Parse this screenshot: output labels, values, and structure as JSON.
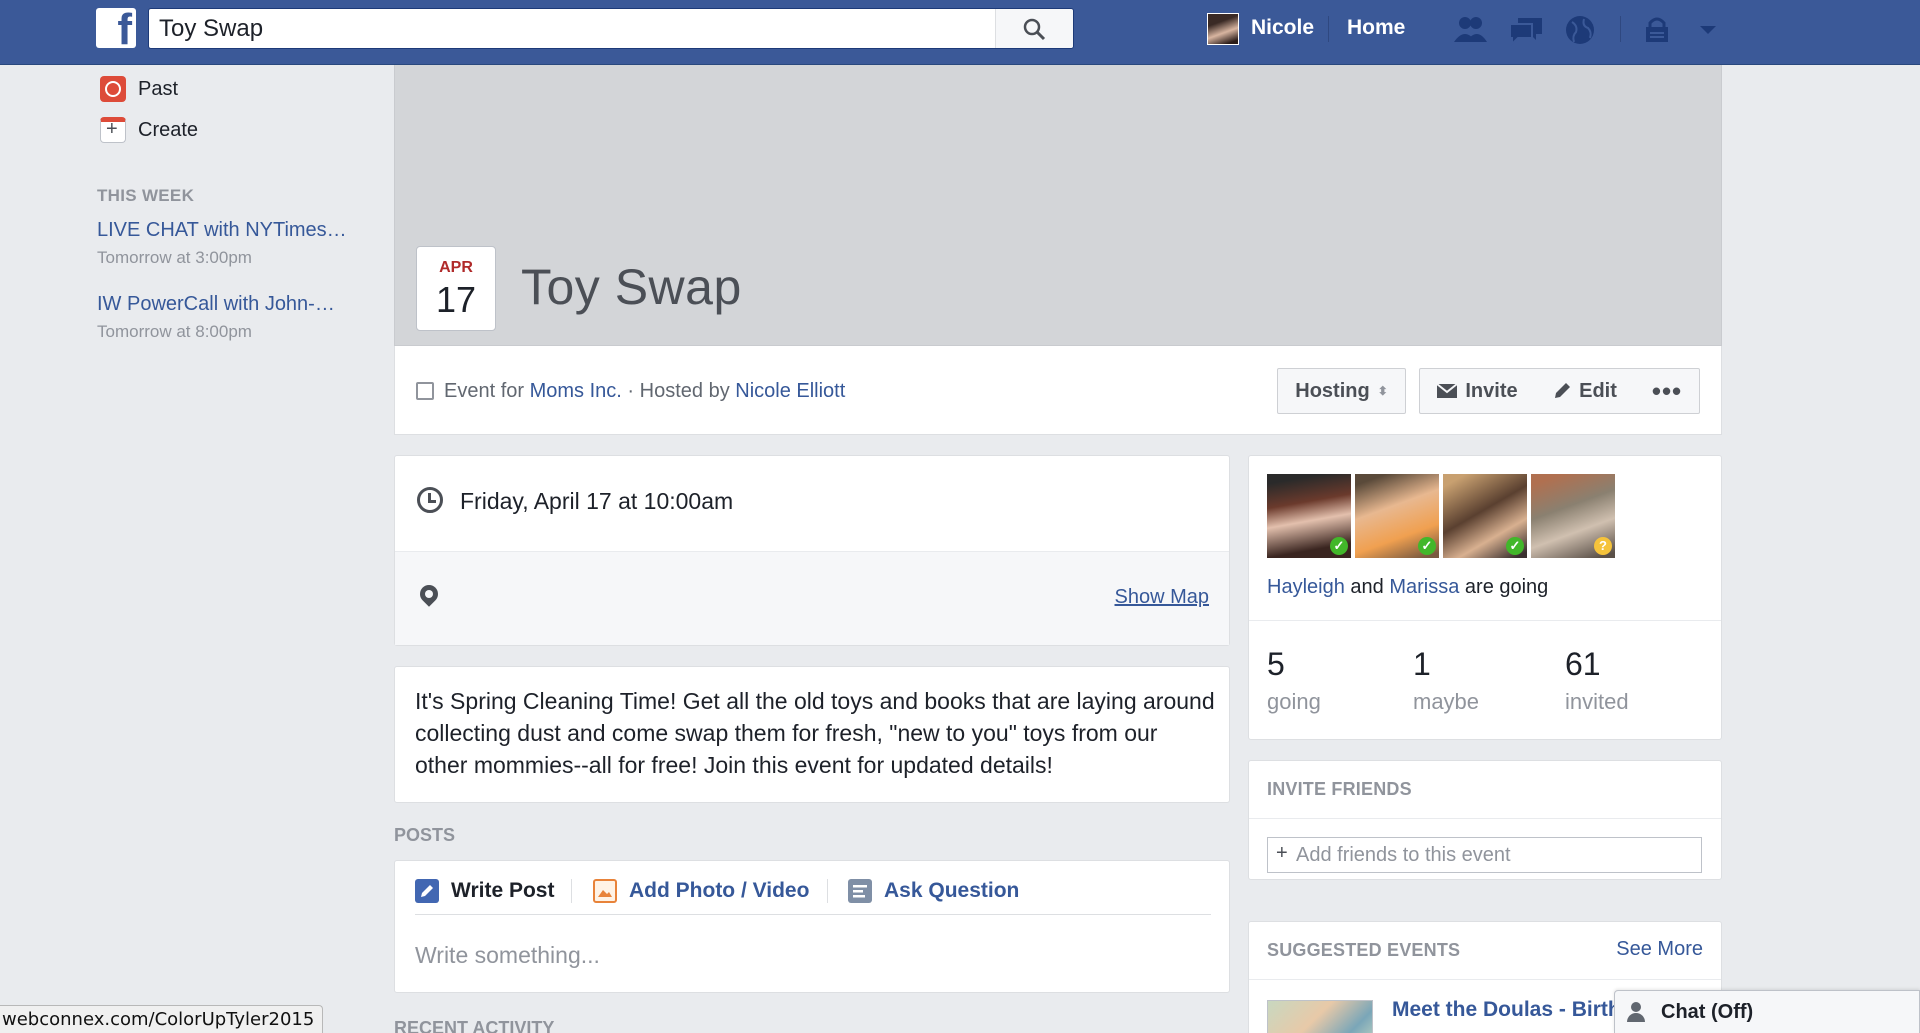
{
  "topbar": {
    "logo": "f",
    "search_value": "Toy Swap",
    "user_name": "Nicole",
    "home_label": "Home",
    "icons": [
      "friend-requests-icon",
      "messages-icon",
      "notifications-globe-icon",
      "privacy-lock-icon",
      "account-menu-chevron-icon"
    ]
  },
  "sidebar": {
    "items": [
      {
        "label": "Past",
        "icon": "clock-icon"
      },
      {
        "label": "Create",
        "icon": "calendar-plus-icon"
      }
    ],
    "section_title": "THIS WEEK",
    "events": [
      {
        "title": "LIVE CHAT with NYTimes…",
        "time": "Tomorrow at 3:00pm"
      },
      {
        "title": "IW PowerCall with John-…",
        "time": "Tomorrow at 8:00pm"
      }
    ]
  },
  "event": {
    "month": "APR",
    "day": "17",
    "title": "Toy Swap",
    "event_for_prefix": "Event for",
    "group": "Moms Inc.",
    "hosted_by_prefix": "· Hosted by",
    "host": "Nicole Elliott",
    "when": "Friday, April 17 at 10:00am",
    "show_map": "Show Map",
    "description": "It's Spring Cleaning Time! Get all the old toys and books that are laying around collecting dust and come swap them for fresh, \"new to you\" toys from our other mommies--all for free! Join this event for updated details!"
  },
  "actions": {
    "hosting": "Hosting",
    "hosting_caret": "⬍",
    "invite": "Invite",
    "edit": "Edit",
    "more": "•••"
  },
  "posts": {
    "section_label": "POSTS",
    "tabs": [
      {
        "label": "Write Post",
        "icon": "pencil-icon"
      },
      {
        "label": "Add Photo / Video",
        "icon": "photo-icon"
      },
      {
        "label": "Ask Question",
        "icon": "poll-icon"
      }
    ],
    "placeholder": "Write something...",
    "recent_label": "RECENT ACTIVITY"
  },
  "guests": {
    "going_names": [
      "Hayleigh",
      "Marissa"
    ],
    "going_joiner": "and",
    "going_suffix": "are going",
    "stats": [
      {
        "num": "5",
        "label": "going"
      },
      {
        "num": "1",
        "label": "maybe"
      },
      {
        "num": "61",
        "label": "invited"
      }
    ]
  },
  "invite_friends": {
    "header": "INVITE FRIENDS",
    "placeholder": "Add friends to this event"
  },
  "suggested": {
    "header": "SUGGESTED EVENTS",
    "see_more": "See More",
    "first_title": "Meet the Doulas - Birth"
  },
  "chat": {
    "label": "Chat (Off)"
  },
  "status_bar": {
    "url": "webconnex.com/ColorUpTyler2015"
  },
  "colors": {
    "brand": "#3b5998",
    "link": "#365899",
    "going_badge": "#42b72a",
    "maybe_badge": "#f5c33b"
  }
}
